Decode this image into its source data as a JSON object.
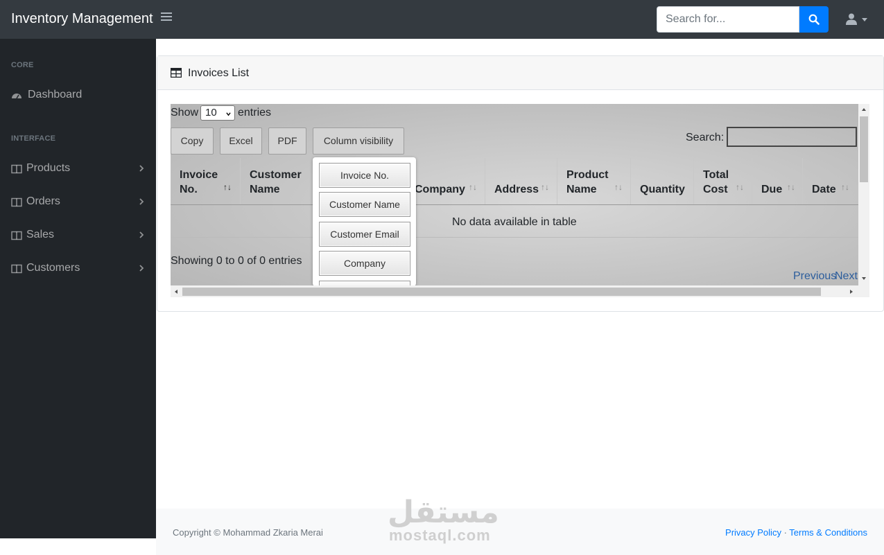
{
  "navbar": {
    "brand": "Inventory Management",
    "search_placeholder": "Search for..."
  },
  "sidebar": {
    "headings": {
      "core": "CORE",
      "interface": "INTERFACE"
    },
    "items": [
      {
        "label": "Dashboard",
        "icon": "tachometer-icon"
      },
      {
        "label": "Products",
        "icon": "columns-icon"
      },
      {
        "label": "Orders",
        "icon": "columns-icon"
      },
      {
        "label": "Sales",
        "icon": "columns-icon"
      },
      {
        "label": "Customers",
        "icon": "columns-icon"
      }
    ]
  },
  "card": {
    "title": "Invoices List",
    "length": {
      "show": "Show",
      "value": "10",
      "entries": "entries"
    },
    "buttons": {
      "copy": "Copy",
      "excel": "Excel",
      "pdf": "PDF",
      "colvis": "Column visibility"
    },
    "search_label": "Search:",
    "columns": [
      {
        "line1": "Invoice",
        "line2": "No."
      },
      {
        "line1": "Customer",
        "line2": "Name"
      },
      {
        "line1": "",
        "line2": "Company"
      },
      {
        "line1": "",
        "line2": "Address"
      },
      {
        "line1": "Product",
        "line2": "Name"
      },
      {
        "line1": "",
        "line2": "Quantity"
      },
      {
        "line1": "Total",
        "line2": "Cost"
      },
      {
        "line1": "",
        "line2": "Due"
      },
      {
        "line1": "",
        "line2": "Date"
      }
    ],
    "empty_message": "No data available in table",
    "info": "Showing 0 to 0 of 0 entries",
    "pager": {
      "previous": "Previous",
      "next": "Next"
    },
    "colvis_options": [
      "Invoice No.",
      "Customer Name",
      "Customer Email",
      "Company",
      ""
    ]
  },
  "footer": {
    "copyright": "Copyright © Mohammad Zkaria Merai",
    "privacy": "Privacy Policy",
    "separator": " · ",
    "terms": "Terms & Conditions",
    "watermark_logo": "مستقل",
    "watermark_text": "mostaql.com"
  },
  "colors": {
    "navbar": "#343a40",
    "sidebar": "#212529",
    "accent": "#007bff"
  }
}
